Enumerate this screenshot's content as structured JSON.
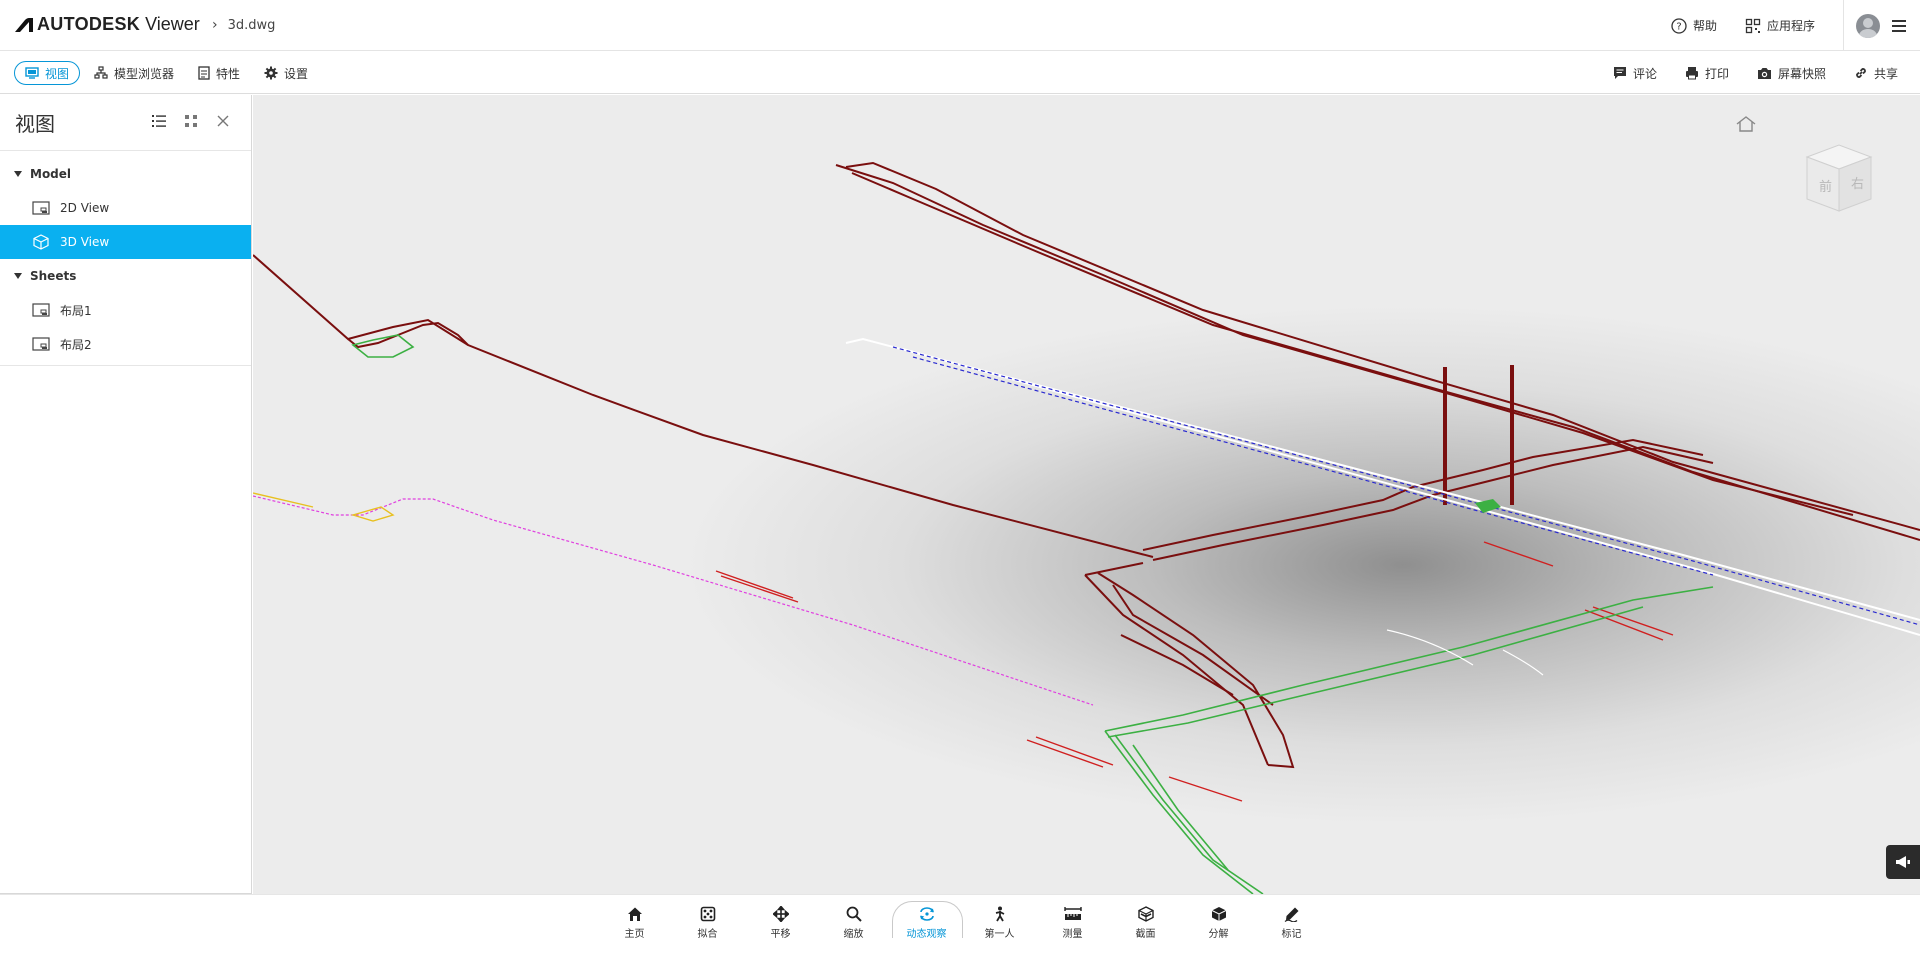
{
  "header": {
    "brand": "AUTODESK",
    "product": "Viewer",
    "filename": "3d.dwg",
    "help_label": "帮助",
    "apps_label": "应用程序"
  },
  "toolbar": {
    "left": [
      {
        "label": "视图",
        "icon": "view-icon"
      },
      {
        "label": "模型浏览器",
        "icon": "model-browser-icon"
      },
      {
        "label": "特性",
        "icon": "properties-icon"
      },
      {
        "label": "设置",
        "icon": "settings-gear-icon"
      }
    ],
    "right": [
      {
        "label": "评论",
        "icon": "comment-icon"
      },
      {
        "label": "打印",
        "icon": "print-icon"
      },
      {
        "label": "屏幕快照",
        "icon": "camera-icon"
      },
      {
        "label": "共享",
        "icon": "link-icon"
      }
    ]
  },
  "sidebar": {
    "title": "视图",
    "groups": [
      {
        "label": "Model",
        "items": [
          {
            "label": "2D View",
            "selected": false
          },
          {
            "label": "3D View",
            "selected": true
          }
        ]
      },
      {
        "label": "Sheets",
        "items": [
          {
            "label": "布局1",
            "selected": false
          },
          {
            "label": "布局2",
            "selected": false
          }
        ]
      }
    ]
  },
  "viewcube": {
    "front": "前",
    "right": "右"
  },
  "bottom_tools": [
    {
      "label": "主页",
      "icon": "home-icon",
      "active": false
    },
    {
      "label": "拟合",
      "icon": "fit-icon",
      "active": false
    },
    {
      "label": "平移",
      "icon": "pan-icon",
      "active": false
    },
    {
      "label": "缩放",
      "icon": "zoom-icon",
      "active": false
    },
    {
      "label": "动态观察",
      "icon": "orbit-icon",
      "active": true
    },
    {
      "label": "第一人",
      "icon": "first-person-icon",
      "active": false
    },
    {
      "label": "测量",
      "icon": "measure-icon",
      "active": false
    },
    {
      "label": "截面",
      "icon": "section-icon",
      "active": false
    },
    {
      "label": "分解",
      "icon": "explode-icon",
      "active": false
    },
    {
      "label": "标记",
      "icon": "markup-icon",
      "active": false
    }
  ],
  "colors": {
    "accent": "#0696d7",
    "selected_row": "#0ab0f0",
    "model_red": "#7a0f0f",
    "model_green": "#3cb043",
    "model_blue": "#2a2ad0",
    "model_magenta": "#e040e0"
  }
}
